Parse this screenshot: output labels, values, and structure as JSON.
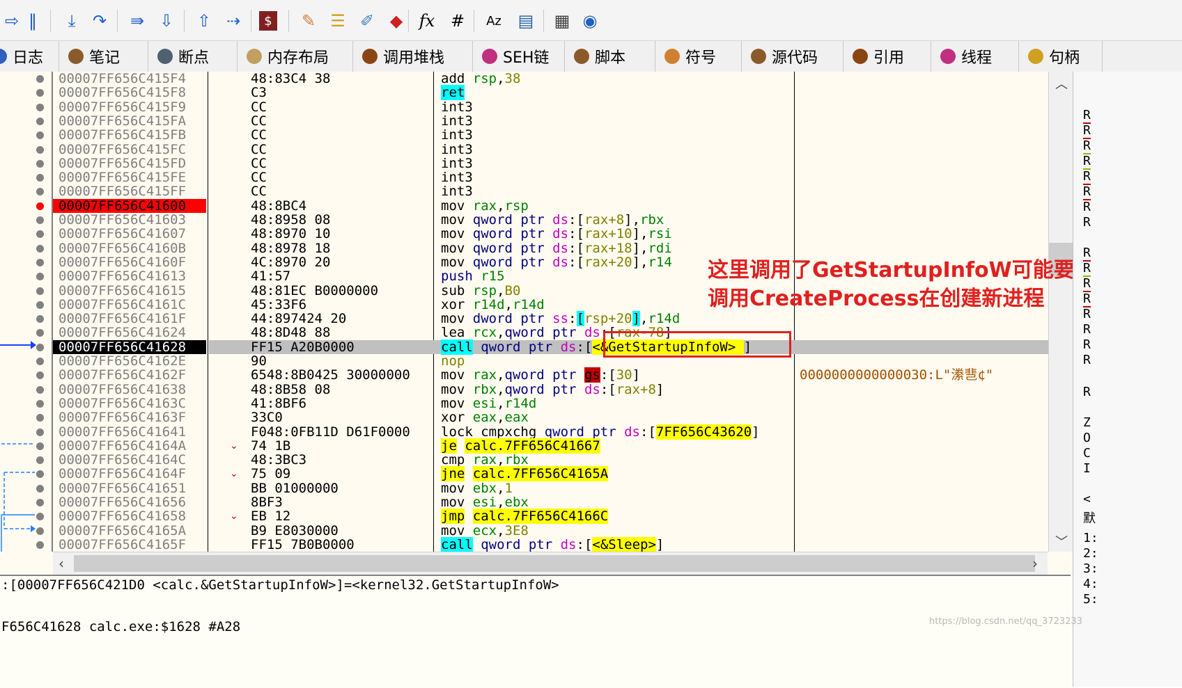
{
  "toolbar": {
    "icons": [
      "run-icon",
      "pause-icon",
      "step-into-icon",
      "step-over-icon",
      "trace-into-icon",
      "trace-over-icon",
      "execute-till-return-icon",
      "run-to-user-code-icon",
      "scylla-icon",
      "patch-icon",
      "comment-icon",
      "label-icon",
      "bookmark-icon",
      "function-icon",
      "hash-icon",
      "font-icon",
      "module-icon",
      "calculator-icon",
      "globe-icon"
    ],
    "glyphs": [
      "⇨",
      "‖",
      "⤓",
      "↷",
      "⇛",
      "⇩",
      "⇧",
      "⇢",
      "$",
      "✎",
      "☰",
      "✐",
      "◆",
      "fx",
      "#",
      "Aᴢ",
      "▤",
      "▦",
      "◉"
    ]
  },
  "tabs": [
    {
      "label": "日志",
      "color": "#3060c0"
    },
    {
      "label": "笔记",
      "color": "#8b5a2b"
    },
    {
      "label": "断点",
      "color": "#506070"
    },
    {
      "label": "内存布局",
      "color": "#c0a060"
    },
    {
      "label": "调用堆栈",
      "color": "#8b4513"
    },
    {
      "label": "SEH链",
      "color": "#c03080"
    },
    {
      "label": "脚本",
      "color": "#8b5a2b"
    },
    {
      "label": "符号",
      "color": "#d08030"
    },
    {
      "label": "源代码",
      "color": "#8b5a2b"
    },
    {
      "label": "引用",
      "color": "#8b4513"
    },
    {
      "label": "线程",
      "color": "#c03080"
    },
    {
      "label": "句柄",
      "color": "#d0a020"
    }
  ],
  "rows": [
    {
      "addr": "00007FF656C415F4",
      "bytes": "48:83C4 38",
      "dis": [
        [
          "add ",
          ""
        ],
        [
          "rsp",
          "reg"
        ],
        [
          ",",
          ""
        ],
        [
          "38",
          "num"
        ]
      ],
      "cmt": ""
    },
    {
      "addr": "00007FF656C415F8",
      "bytes": "C3",
      "dis": [
        [
          "ret",
          "kw-cyan"
        ]
      ],
      "cmt": ""
    },
    {
      "addr": "00007FF656C415F9",
      "bytes": "CC",
      "dis": [
        [
          "int3",
          ""
        ]
      ],
      "cmt": ""
    },
    {
      "addr": "00007FF656C415FA",
      "bytes": "CC",
      "dis": [
        [
          "int3",
          ""
        ]
      ],
      "cmt": ""
    },
    {
      "addr": "00007FF656C415FB",
      "bytes": "CC",
      "dis": [
        [
          "int3",
          ""
        ]
      ],
      "cmt": ""
    },
    {
      "addr": "00007FF656C415FC",
      "bytes": "CC",
      "dis": [
        [
          "int3",
          ""
        ]
      ],
      "cmt": ""
    },
    {
      "addr": "00007FF656C415FD",
      "bytes": "CC",
      "dis": [
        [
          "int3",
          ""
        ]
      ],
      "cmt": ""
    },
    {
      "addr": "00007FF656C415FE",
      "bytes": "CC",
      "dis": [
        [
          "int3",
          ""
        ]
      ],
      "cmt": ""
    },
    {
      "addr": "00007FF656C415FF",
      "bytes": "CC",
      "dis": [
        [
          "int3",
          ""
        ]
      ],
      "cmt": ""
    },
    {
      "addr": "00007FF656C41600",
      "bytes": "48:8BC4",
      "dis": [
        [
          "mov ",
          ""
        ],
        [
          "rax",
          "reg"
        ],
        [
          ",",
          ""
        ],
        [
          "rsp",
          "reg"
        ]
      ],
      "cmt": "",
      "addrStyle": "hl-red",
      "bp": "red"
    },
    {
      "addr": "00007FF656C41603",
      "bytes": "48:8958 08",
      "dis": [
        [
          "mov ",
          ""
        ],
        [
          "qword ptr ",
          "blu"
        ],
        [
          "ds",
          "seg"
        ],
        [
          ":[",
          ""
        ],
        [
          "rax+8",
          "num"
        ],
        [
          "],",
          ""
        ],
        [
          "rbx",
          "reg"
        ]
      ],
      "cmt": ""
    },
    {
      "addr": "00007FF656C41607",
      "bytes": "48:8970 10",
      "dis": [
        [
          "mov ",
          ""
        ],
        [
          "qword ptr ",
          "blu"
        ],
        [
          "ds",
          "seg"
        ],
        [
          ":[",
          ""
        ],
        [
          "rax+10",
          "num"
        ],
        [
          "],",
          ""
        ],
        [
          "rsi",
          "reg"
        ]
      ],
      "cmt": ""
    },
    {
      "addr": "00007FF656C4160B",
      "bytes": "48:8978 18",
      "dis": [
        [
          "mov ",
          ""
        ],
        [
          "qword ptr ",
          "blu"
        ],
        [
          "ds",
          "seg"
        ],
        [
          ":[",
          ""
        ],
        [
          "rax+18",
          "num"
        ],
        [
          "],",
          ""
        ],
        [
          "rdi",
          "reg"
        ]
      ],
      "cmt": ""
    },
    {
      "addr": "00007FF656C4160F",
      "bytes": "4C:8970 20",
      "dis": [
        [
          "mov ",
          ""
        ],
        [
          "qword ptr ",
          "blu"
        ],
        [
          "ds",
          "seg"
        ],
        [
          ":[",
          ""
        ],
        [
          "rax+20",
          "num"
        ],
        [
          "],",
          ""
        ],
        [
          "r14",
          "reg"
        ]
      ],
      "cmt": ""
    },
    {
      "addr": "00007FF656C41613",
      "bytes": "41:57",
      "dis": [
        [
          "push ",
          "blu"
        ],
        [
          "r15",
          "reg"
        ]
      ],
      "cmt": ""
    },
    {
      "addr": "00007FF656C41615",
      "bytes": "48:81EC B0000000",
      "dis": [
        [
          "sub ",
          ""
        ],
        [
          "rsp",
          "reg"
        ],
        [
          ",",
          ""
        ],
        [
          "B0",
          "num"
        ]
      ],
      "cmt": ""
    },
    {
      "addr": "00007FF656C4161C",
      "bytes": "45:33F6",
      "dis": [
        [
          "xor ",
          ""
        ],
        [
          "r14d",
          "reg"
        ],
        [
          ",",
          ""
        ],
        [
          "r14d",
          "reg"
        ]
      ],
      "cmt": ""
    },
    {
      "addr": "00007FF656C4161F",
      "bytes": "44:897424 20",
      "dis": [
        [
          "mov ",
          ""
        ],
        [
          "dword ptr ",
          "blu"
        ],
        [
          "ss",
          "seg"
        ],
        [
          ":",
          ""
        ],
        [
          "[",
          "kw-cyan"
        ],
        [
          "rsp+20",
          "num"
        ],
        [
          "]",
          "kw-cyan"
        ],
        [
          ",",
          ""
        ],
        [
          "r14d",
          "reg"
        ]
      ],
      "cmt": ""
    },
    {
      "addr": "00007FF656C41624",
      "bytes": "48:8D48 88",
      "dis": [
        [
          "lea ",
          ""
        ],
        [
          "rcx",
          "reg"
        ],
        [
          ",",
          ""
        ],
        [
          "qword ptr ",
          "blu"
        ],
        [
          "ds",
          "seg"
        ],
        [
          ":[",
          ""
        ],
        [
          "rax-78",
          "num"
        ],
        [
          "]",
          ""
        ]
      ],
      "cmt": ""
    },
    {
      "addr": "00007FF656C41628",
      "bytes": "FF15 A20B0000",
      "dis": [
        [
          "call",
          "kw-cyan"
        ],
        [
          " qword ptr ",
          "blu"
        ],
        [
          "ds",
          "seg"
        ],
        [
          ":[",
          ""
        ],
        [
          "<&GetStartupInfoW> ",
          "kw-yel"
        ],
        [
          "]",
          ""
        ]
      ],
      "cmt": "",
      "addrStyle": "hl-black",
      "current": true
    },
    {
      "addr": "00007FF656C4162E",
      "bytes": "90",
      "dis": [
        [
          "nop",
          "num"
        ]
      ],
      "cmt": ""
    },
    {
      "addr": "00007FF656C4162F",
      "bytes": "6548:8B0425 30000000",
      "dis": [
        [
          "mov ",
          ""
        ],
        [
          "rax",
          "reg"
        ],
        [
          ",",
          ""
        ],
        [
          "qword ptr ",
          "blu"
        ],
        [
          "gs",
          "seg"
        ],
        [
          ":[",
          ""
        ],
        [
          "30",
          "num"
        ],
        [
          "]",
          ""
        ]
      ],
      "cmt": "0000000000000030:L\"潫䨽¢\""
    },
    {
      "addr": "00007FF656C41638",
      "bytes": "48:8B58 08",
      "dis": [
        [
          "mov ",
          ""
        ],
        [
          "rbx",
          "reg"
        ],
        [
          ",",
          ""
        ],
        [
          "qword ptr ",
          "blu"
        ],
        [
          "ds",
          "seg"
        ],
        [
          ":[",
          ""
        ],
        [
          "rax+8",
          "num"
        ],
        [
          "]",
          ""
        ]
      ],
      "cmt": ""
    },
    {
      "addr": "00007FF656C4163C",
      "bytes": "41:8BF6",
      "dis": [
        [
          "mov ",
          ""
        ],
        [
          "esi",
          "reg"
        ],
        [
          ",",
          ""
        ],
        [
          "r14d",
          "reg"
        ]
      ],
      "cmt": ""
    },
    {
      "addr": "00007FF656C4163F",
      "bytes": "33C0",
      "dis": [
        [
          "xor ",
          ""
        ],
        [
          "eax",
          "reg"
        ],
        [
          ",",
          ""
        ],
        [
          "eax",
          "reg"
        ]
      ],
      "cmt": ""
    },
    {
      "addr": "00007FF656C41641",
      "bytes": "F048:0FB11D D61F0000",
      "dis": [
        [
          "lock cmpxchg ",
          ""
        ],
        [
          "qword ptr ",
          "blu"
        ],
        [
          "ds",
          "seg"
        ],
        [
          ":[",
          ""
        ],
        [
          "7FF656C43620",
          "kw-yel"
        ],
        [
          "]",
          ""
        ]
      ],
      "cmt": ""
    },
    {
      "addr": "00007FF656C4164A",
      "bytes": "74 1B",
      "dis": [
        [
          "je",
          "kw-yel"
        ],
        [
          " ",
          ""
        ],
        [
          "calc.7FF656C41667",
          "kw-yel"
        ]
      ],
      "cmt": "",
      "jmp": true
    },
    {
      "addr": "00007FF656C4164C",
      "bytes": "48:3BC3",
      "dis": [
        [
          "cmp ",
          ""
        ],
        [
          "rax",
          "reg"
        ],
        [
          ",",
          ""
        ],
        [
          "rbx",
          "reg"
        ]
      ],
      "cmt": ""
    },
    {
      "addr": "00007FF656C4164F",
      "bytes": "75 09",
      "dis": [
        [
          "jne",
          "kw-yel"
        ],
        [
          " ",
          ""
        ],
        [
          "calc.7FF656C4165A",
          "kw-yel"
        ]
      ],
      "cmt": "",
      "jmp": true
    },
    {
      "addr": "00007FF656C41651",
      "bytes": "BB 01000000",
      "dis": [
        [
          "mov ",
          ""
        ],
        [
          "ebx",
          "reg"
        ],
        [
          ",",
          ""
        ],
        [
          "1",
          "num"
        ]
      ],
      "cmt": ""
    },
    {
      "addr": "00007FF656C41656",
      "bytes": "8BF3",
      "dis": [
        [
          "mov ",
          ""
        ],
        [
          "esi",
          "reg"
        ],
        [
          ",",
          ""
        ],
        [
          "ebx",
          "reg"
        ]
      ],
      "cmt": ""
    },
    {
      "addr": "00007FF656C41658",
      "bytes": "EB 12",
      "dis": [
        [
          "jmp",
          "kw-yel"
        ],
        [
          " ",
          ""
        ],
        [
          "calc.7FF656C4166C",
          "kw-yel"
        ]
      ],
      "cmt": "",
      "jmp": true
    },
    {
      "addr": "00007FF656C4165A",
      "bytes": "B9 E8030000",
      "dis": [
        [
          "mov ",
          ""
        ],
        [
          "ecx",
          "reg"
        ],
        [
          ",",
          ""
        ],
        [
          "3E8",
          "num"
        ]
      ],
      "cmt": ""
    },
    {
      "addr": "00007FF656C4165F",
      "bytes": "FF15 7B0B0000",
      "dis": [
        [
          "call",
          "kw-cyan"
        ],
        [
          " qword ptr ",
          "blu"
        ],
        [
          "ds",
          "seg"
        ],
        [
          ":[",
          ""
        ],
        [
          "<&Sleep>",
          "kw-yel"
        ],
        [
          "]",
          ""
        ]
      ],
      "cmt": ""
    }
  ],
  "annotation": {
    "line1": "这里调用了GetStartupInfoW可能要",
    "line2": "调用CreateProcess在创建新进程"
  },
  "status": {
    "line1": ":[00007FF656C421D0 <calc.&GetStartupInfoW>]=<kernel32.GetStartupInfoW>",
    "line2": "F656C41628 calc.exe:$1628 #A28"
  },
  "sidepanel": {
    "letters": [
      "R",
      "R",
      "R",
      "R",
      "R",
      "R",
      "R",
      "R",
      "R",
      "R",
      "R",
      "R",
      "R",
      "R",
      "R",
      "R",
      "R",
      "Z",
      "O",
      "C",
      "I",
      "<",
      "默",
      "1:",
      "2:",
      "3:",
      "4:",
      "5:"
    ]
  },
  "watermark": "https://blog.csdn.net/qq_3723233",
  "colors": {
    "breakpoint": "#ff0000",
    "annotation": "#e02020",
    "current_row": "#c0c0c0"
  }
}
